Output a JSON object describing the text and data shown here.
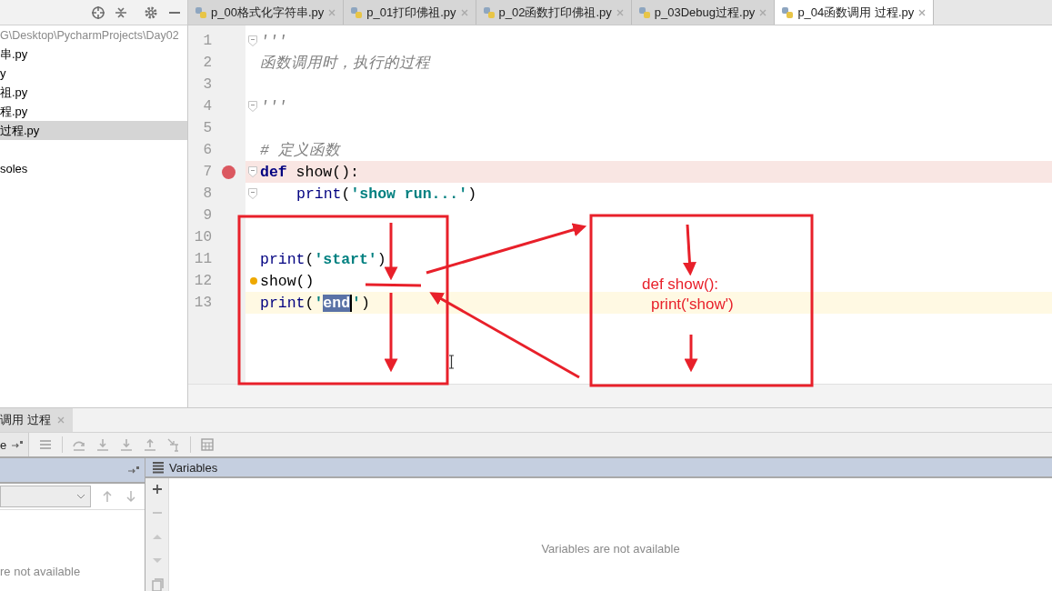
{
  "project_panel": {
    "path": "G\\Desktop\\PycharmProjects\\Day02",
    "items": [
      {
        "label": "串.py",
        "kind": "file",
        "selected": false
      },
      {
        "label": "y",
        "kind": "file",
        "selected": false
      },
      {
        "label": "祖.py",
        "kind": "file",
        "selected": false
      },
      {
        "label": "程.py",
        "kind": "file",
        "selected": false
      },
      {
        "label": "过程.py",
        "kind": "file",
        "selected": true
      },
      {
        "label": "soles",
        "kind": "root",
        "selected": false
      }
    ]
  },
  "tabs": [
    {
      "label": "p_00格式化字符串.py",
      "selected": false
    },
    {
      "label": "p_01打印佛祖.py",
      "selected": false
    },
    {
      "label": "p_02函数打印佛祖.py",
      "selected": false
    },
    {
      "label": "p_03Debug过程.py",
      "selected": false
    },
    {
      "label": "p_04函数调用 过程.py",
      "selected": true
    }
  ],
  "editor": {
    "lines": [
      {
        "number": "1",
        "fold": true,
        "breakpoint": false,
        "current_line": false,
        "indented": false,
        "tokens": [
          {
            "kind": "docstring",
            "text": "'''"
          }
        ]
      },
      {
        "number": "2",
        "fold": false,
        "breakpoint": false,
        "current_line": false,
        "indented": false,
        "tokens": [
          {
            "kind": "docstring",
            "text": "函数调用时，执行的过程"
          }
        ]
      },
      {
        "number": "3",
        "fold": false,
        "breakpoint": false,
        "current_line": false
      },
      {
        "number": "4",
        "fold": true,
        "breakpoint": false,
        "current_line": false,
        "indented": false,
        "tokens": [
          {
            "kind": "docstring",
            "text": "'''"
          }
        ]
      },
      {
        "number": "5",
        "fold": false,
        "breakpoint": false,
        "current_line": false
      },
      {
        "number": "6",
        "fold": false,
        "breakpoint": false,
        "current_line": false,
        "indented": false,
        "tokens": [
          {
            "kind": "comment",
            "text": "# 定义函数"
          }
        ]
      },
      {
        "number": "7",
        "fold": true,
        "breakpoint": true,
        "current_line": false,
        "indented": false,
        "tokens": [
          {
            "kind": "keyword",
            "text": "def"
          },
          {
            "kind": "plain",
            "text": " show():"
          }
        ]
      },
      {
        "number": "8",
        "fold": true,
        "breakpoint": false,
        "current_line": false,
        "indented": true,
        "tokens": [
          {
            "kind": "builtin",
            "text": "print"
          },
          {
            "kind": "plain",
            "text": "("
          },
          {
            "kind": "string",
            "text": "'show run...'"
          },
          {
            "kind": "plain",
            "text": ")"
          }
        ]
      },
      {
        "number": "9",
        "fold": false,
        "breakpoint": false,
        "current_line": false
      },
      {
        "number": "10",
        "fold": false,
        "breakpoint": false,
        "current_line": false
      },
      {
        "number": "11",
        "fold": false,
        "breakpoint": false,
        "current_line": false,
        "indented": false,
        "tokens": [
          {
            "kind": "builtin",
            "text": "print"
          },
          {
            "kind": "plain",
            "text": "("
          },
          {
            "kind": "string",
            "text": "'start'"
          },
          {
            "kind": "plain",
            "text": ")"
          }
        ]
      },
      {
        "number": "12",
        "fold": false,
        "breakpoint": false,
        "current_line": false,
        "indented": false,
        "tokens": [
          {
            "kind": "plain",
            "text": "show()"
          }
        ]
      },
      {
        "number": "13",
        "fold": false,
        "breakpoint": false,
        "current_line": true,
        "indented": false,
        "tokens": [
          {
            "kind": "builtin",
            "text": "print"
          },
          {
            "kind": "plain",
            "text": "("
          },
          {
            "kind": "string",
            "text": "'"
          },
          {
            "kind": "selected",
            "text": "end"
          },
          {
            "kind": "string",
            "text": "'"
          },
          {
            "kind": "plain",
            "text": ")"
          }
        ]
      }
    ]
  },
  "annotation": {
    "lines": [
      "def show():",
      "print('show')"
    ]
  },
  "debug_panel": {
    "tab": "调用 过程",
    "toolbar_label": "e",
    "frames_empty": "re not available",
    "variables_title": "Variables",
    "variables_empty": "Variables are not available"
  }
}
